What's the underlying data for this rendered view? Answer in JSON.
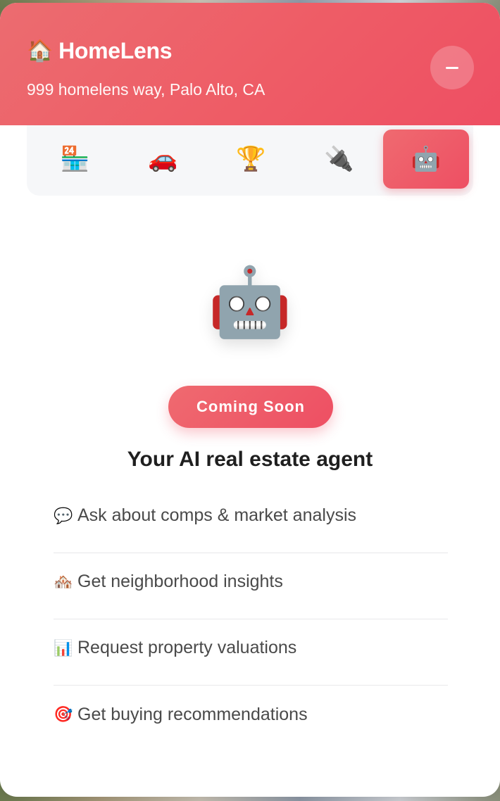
{
  "header": {
    "brand_icon": "🏠",
    "brand_name": "HomeLens",
    "address": "999 homelens way, Palo Alto, CA",
    "minimize_icon": "minus-icon"
  },
  "tabs": [
    {
      "icon": "🏪",
      "name": "convenience-store-icon",
      "active": false
    },
    {
      "icon": "🚗",
      "name": "car-icon",
      "active": false
    },
    {
      "icon": "🏆",
      "name": "trophy-icon",
      "active": false
    },
    {
      "icon": "🔌",
      "name": "plug-icon",
      "active": false
    },
    {
      "icon": "🤖",
      "name": "robot-icon",
      "active": true
    }
  ],
  "main": {
    "hero_icon": "🤖",
    "badge": "Coming Soon",
    "headline": "Your AI real estate agent",
    "features": [
      {
        "icon": "💬",
        "icon_name": "speech-bubble-icon",
        "text": "Ask about comps & market analysis"
      },
      {
        "icon": "🏘️",
        "icon_name": "houses-icon",
        "text": "Get neighborhood insights"
      },
      {
        "icon": "📊",
        "icon_name": "bar-chart-icon",
        "text": "Request property valuations"
      },
      {
        "icon": "🎯",
        "icon_name": "target-icon",
        "text": "Get buying recommendations"
      }
    ]
  },
  "colors": {
    "accent": "#ee5565",
    "accent_light": "#ef6a70",
    "tab_bar_bg": "#f6f7f9",
    "text_dark": "#1f1f1f",
    "text_muted": "#4a4a4a"
  }
}
